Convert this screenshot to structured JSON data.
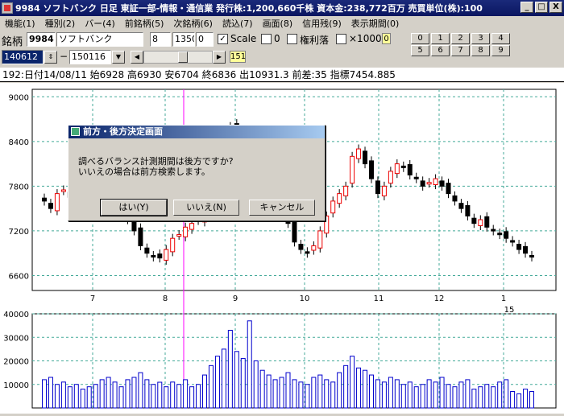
{
  "window": {
    "title": "9984 ソフトバンク 日足 東証一部-情報・通信業 発行株:1,200,660千株 資本金:238,772百万 売買単位(株):100",
    "minimize": "_",
    "maximize": "□",
    "close": "X"
  },
  "menu": [
    "機能(1)",
    "種別(2)",
    "バー(4)",
    "前銘柄(5)",
    "次銘柄(6)",
    "読込(7)",
    "画面(8)",
    "信用残(9)",
    "表示期間(0)"
  ],
  "toolbar": {
    "code_label": "銘柄",
    "code": "9984",
    "name": "ソフトバンク",
    "f1": "8",
    "f2": "1350",
    "f3": "0",
    "scale_checked": "✓",
    "scale_label": "Scale",
    "chk2_label": "0",
    "kenri_label": "権利落",
    "mult_label": "×1000",
    "mult_badge": "0",
    "numpad": [
      "0",
      "1",
      "2",
      "3",
      "4",
      "5",
      "6",
      "7",
      "8",
      "9"
    ]
  },
  "nav": {
    "from_date": "140612",
    "dash": "−",
    "to_date": "150116",
    "dropdown": "▼",
    "prev": "◀",
    "next": "▶",
    "count": "151"
  },
  "info_line": "192:日付14/08/11 始6928 高6930 安6704 終6836 出10931.3 前差:35 指標7454.885",
  "chart_data": {
    "type": "candlestick+bar",
    "price_axis": {
      "ticks": [
        9000,
        8400,
        7800,
        7200,
        6600
      ],
      "range": [
        6400,
        9100
      ]
    },
    "volume_axis": {
      "ticks": [
        40000,
        30000,
        20000,
        10000
      ],
      "range": [
        0,
        40000
      ]
    },
    "months": [
      "7",
      "8",
      "9",
      "10",
      "11",
      "12",
      "1"
    ],
    "year_marker": "15",
    "closes": [
      7600,
      7500,
      7700,
      7750,
      7650,
      7700,
      7600,
      7450,
      7550,
      7700,
      7650,
      7500,
      7400,
      7350,
      7200,
      7000,
      6900,
      6850,
      6836,
      6950,
      7100,
      7150,
      7250,
      7300,
      7350,
      7500,
      7700,
      8000,
      8300,
      8600,
      8500,
      8400,
      8200,
      8100,
      7950,
      7800,
      7700,
      7500,
      7300,
      7050,
      6950,
      6900,
      7000,
      7200,
      7400,
      7600,
      7700,
      7800,
      8200,
      8300,
      8100,
      7900,
      7700,
      7800,
      8000,
      8100,
      8050,
      7950,
      7900,
      7800,
      7850,
      7900,
      7800,
      7700,
      7600,
      7500,
      7400,
      7300,
      7350,
      7250,
      7200,
      7150,
      7100,
      7050,
      6950,
      6900,
      6850
    ],
    "volumes": [
      12000,
      13000,
      10000,
      11000,
      9000,
      10000,
      8000,
      9000,
      10000,
      12000,
      13000,
      11000,
      9000,
      12000,
      13000,
      15000,
      12000,
      10000,
      10931,
      9000,
      11000,
      10000,
      12000,
      9000,
      10000,
      14000,
      18000,
      22000,
      25000,
      33000,
      24000,
      21000,
      37000,
      20000,
      16000,
      14000,
      12000,
      13000,
      15000,
      12000,
      11000,
      10000,
      13000,
      14000,
      12000,
      11000,
      15000,
      18000,
      22000,
      17000,
      16000,
      14000,
      12000,
      11000,
      13000,
      12000,
      10000,
      11000,
      9000,
      10000,
      12000,
      11000,
      13000,
      10000,
      9000,
      11000,
      12000,
      8000,
      9000,
      10000,
      9000,
      11000,
      12000,
      7000,
      6000,
      8000,
      7000
    ]
  },
  "dialog": {
    "title": "前方・後方決定画面",
    "line1": "調べるバランス計測期間は後方ですか?",
    "line2": "いいえの場合は前方検索します。",
    "yes": "はい(Y)",
    "no": "いいえ(N)",
    "cancel": "キャンセル"
  }
}
